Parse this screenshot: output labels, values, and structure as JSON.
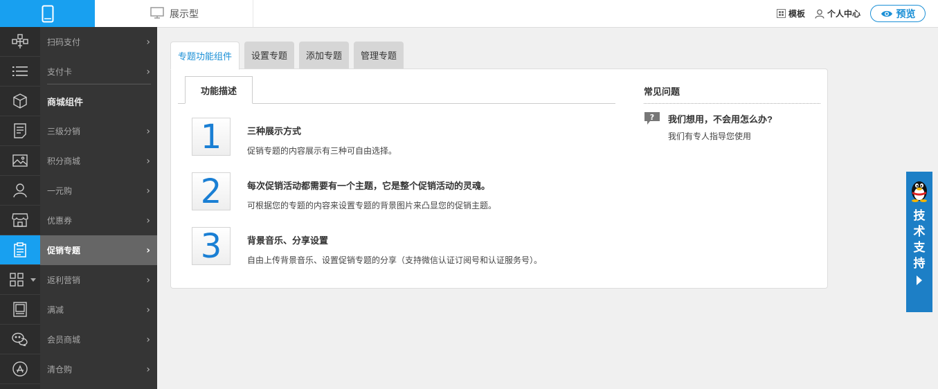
{
  "topbar": {
    "display_label": "展示型",
    "template_label": "模板",
    "account_label": "个人中心",
    "preview_label": "预览"
  },
  "icons": [
    "qrcode-pay-icon",
    "list-icon",
    "box-icon",
    "document-icon",
    "image-icon",
    "user-icon",
    "store-icon",
    "clipboard-icon",
    "grid-icon",
    "frame-icon",
    "chat-icon",
    "appstore-icon"
  ],
  "menu": {
    "items": [
      {
        "label": "扫码支付"
      },
      {
        "label": "支付卡"
      },
      {
        "label": "商城组件"
      },
      {
        "label": "三级分销"
      },
      {
        "label": "积分商城"
      },
      {
        "label": "一元购"
      },
      {
        "label": "优惠券"
      },
      {
        "label": "促销专题"
      },
      {
        "label": "返利营销"
      },
      {
        "label": "满减"
      },
      {
        "label": "会员商城"
      },
      {
        "label": "清仓购"
      }
    ]
  },
  "tabs": [
    {
      "label": "专题功能组件"
    },
    {
      "label": "设置专题"
    },
    {
      "label": "添加专题"
    },
    {
      "label": "管理专题"
    }
  ],
  "subtab": {
    "label": "功能描述"
  },
  "features": [
    {
      "number": "1",
      "title": "三种展示方式",
      "desc": "促销专题的内容展示有三种可自由选择。"
    },
    {
      "number": "2",
      "title": "每次促销活动都需要有一个主题，它是整个促销活动的灵魂。",
      "desc": "可根据您的专题的内容来设置专题的背景图片来凸显您的促销主题。"
    },
    {
      "number": "3",
      "title": "背景音乐、分享设置",
      "desc": "自由上传背景音乐、设置促销专题的分享（支持微信认证订阅号和认证服务号）。"
    }
  ],
  "faq": {
    "title": "常见问题",
    "question": "我们想用，不会用怎么办?",
    "answer": "我们有专人指导您使用"
  },
  "support": {
    "label": "技术支持"
  },
  "colors": {
    "accent": "#18a0f0",
    "number": "#1a7fd4",
    "support": "#1d7fc6"
  }
}
